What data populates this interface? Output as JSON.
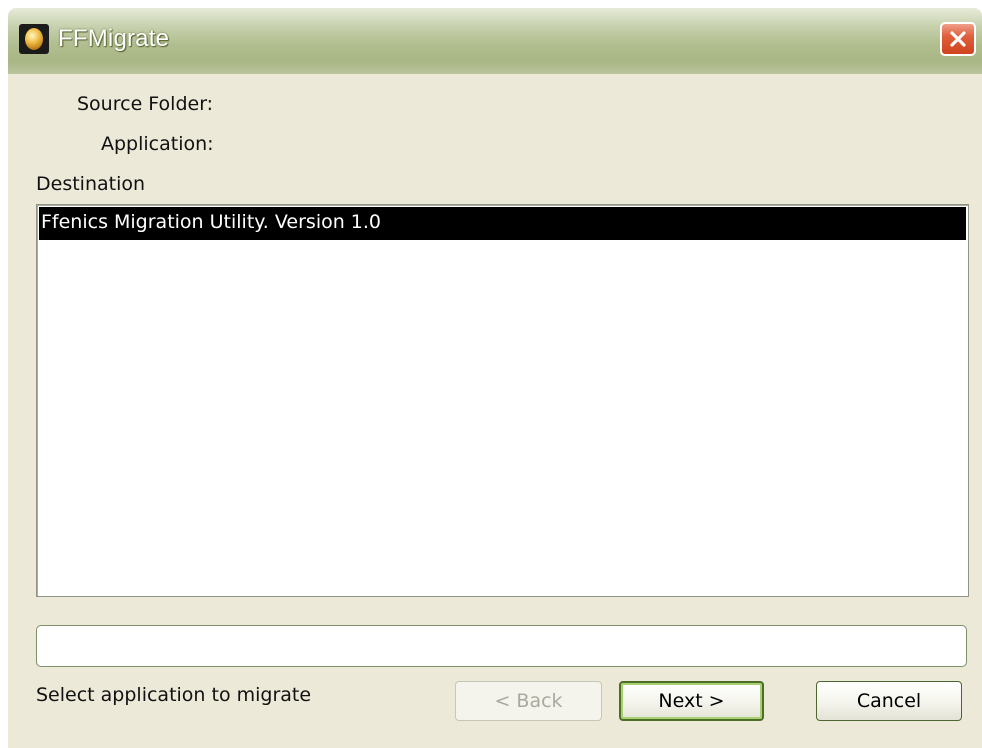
{
  "window": {
    "title": "FFMigrate",
    "close_icon": "close-icon"
  },
  "form": {
    "source_folder_label": "Source Folder:",
    "application_label": "Application:",
    "destination_label": "Destination"
  },
  "list": {
    "items": [
      {
        "label": "Ffenics Migration Utility. Version 1.0",
        "selected": true
      }
    ]
  },
  "path_field": {
    "value": ""
  },
  "status": {
    "text": "Select application to migrate"
  },
  "buttons": {
    "back": "< Back",
    "next": "Next >",
    "cancel": "Cancel"
  }
}
